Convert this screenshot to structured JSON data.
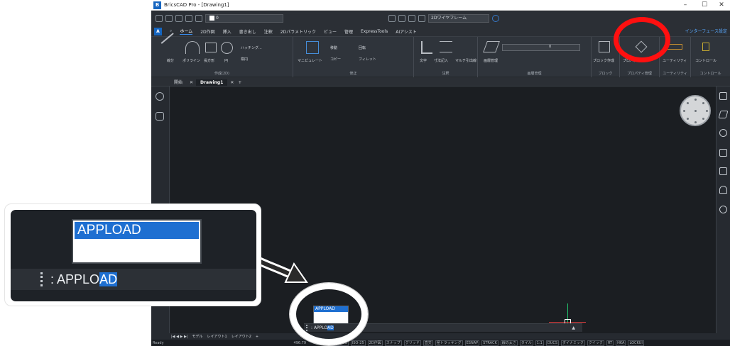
{
  "window": {
    "title": "BricsCAD Pro - [Drawing1]",
    "logo": "B",
    "minimize": "–",
    "maximize": "☐",
    "close": "✕"
  },
  "qat": {
    "layer_value": "0",
    "workspace": "2Dワイヤフレーム"
  },
  "menu": {
    "logo": "A",
    "items": [
      "ホーム",
      "2D作図",
      "挿入",
      "書き出し",
      "注釈",
      "2Dパラメトリック",
      "ビュー",
      "管理",
      "ExpressTools",
      "AIアシスト"
    ],
    "active": "ホーム",
    "right_label": "インターフェース設定"
  },
  "ribbon": {
    "draw": {
      "labels": [
        "線分",
        "ポリライン",
        "長方形",
        "円"
      ],
      "extra": [
        "ハッチング...",
        "楕円"
      ],
      "title": "作成(2D)"
    },
    "modify": {
      "labels": [
        "マニピュレート",
        "移動",
        "コピー",
        "回転",
        "フィレット"
      ],
      "title": "修正"
    },
    "annotate": {
      "labels": [
        "文字",
        "寸法記入",
        "マルチ引出線"
      ],
      "title": "注釈"
    },
    "layers": {
      "labels": [
        "画層管理"
      ],
      "current": "0",
      "title": "画層管理"
    },
    "block": {
      "labels": [
        "ブロック作成"
      ],
      "title": "ブロック"
    },
    "props": {
      "labels": [
        "プロパティ管理"
      ],
      "title": "プロパティ管理"
    },
    "utility": {
      "labels": [
        "ユーティリティ"
      ],
      "title": "ユーティリティ"
    },
    "control": {
      "labels": [
        "コントロール"
      ],
      "title": "コントロール"
    }
  },
  "doctabs": [
    "開始",
    "Drawing1"
  ],
  "command": {
    "popup_item": "APPLOAD",
    "prompt_prefix": ":",
    "typed_plain": "APPLO",
    "typed_selected": "AD",
    "arrow": "▲"
  },
  "layout_tabs": [
    "モデル",
    "レイアウト1",
    "レイアウト2",
    "+"
  ],
  "status": {
    "ready": "Ready",
    "coords": "496.79",
    "items": [
      "Standard",
      "ISO-25",
      "2D作図",
      "スナップ",
      "グリッド",
      "直交",
      "極トラッキング",
      "ESNAP",
      "STRACK",
      "線の太さ",
      "タイル",
      "1:1",
      "DUCS",
      "ダイナミック",
      "クイック",
      "RT",
      "HKA",
      "LOCKUI"
    ]
  },
  "colors": {
    "accent": "#1e6fd1",
    "annotation_red": "#ff1010",
    "annotation_white": "#ffffff",
    "canvas": "#1b1e22"
  }
}
